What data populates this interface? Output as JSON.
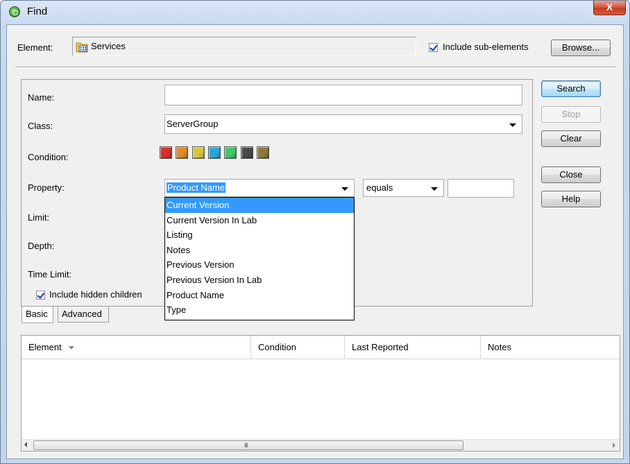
{
  "window": {
    "title": "Find",
    "close_glyph": "X"
  },
  "element": {
    "label": "Element:",
    "value": "Services",
    "icon": "services-folder-icon"
  },
  "include_sub_elements": {
    "label": "Include sub-elements",
    "checked": true
  },
  "buttons": {
    "browse": "Browse...",
    "search": "Search",
    "stop": "Stop",
    "clear": "Clear",
    "close": "Close",
    "help": "Help"
  },
  "form": {
    "name_label": "Name:",
    "name_value": "",
    "class_label": "Class:",
    "class_value": "ServerGroup",
    "condition_label": "Condition:",
    "condition_colors": [
      "#d8302a",
      "#e38a2a",
      "#d8c63a",
      "#2aa8d8",
      "#3ec86a",
      "#4a4a4a",
      "#8c7a3a"
    ],
    "property_label": "Property:",
    "property_value": "Product Name",
    "operator_value": "equals",
    "property_text_value": "",
    "limit_label": "Limit:",
    "depth_label": "Depth:",
    "time_limit_label": "Time Limit:",
    "include_hidden_label": "Include hidden children",
    "include_hidden_checked": true
  },
  "property_options": [
    "Current Version",
    "Current Version In Lab",
    "Listing",
    "Notes",
    "Previous Version",
    "Previous Version In Lab",
    "Product Name",
    "Type"
  ],
  "property_selected_option": "Current Version",
  "tabs": [
    "Basic",
    "Advanced"
  ],
  "active_tab": "Basic",
  "table": {
    "columns": [
      "Element",
      "Condition",
      "Last Reported",
      "Notes"
    ],
    "rows": []
  },
  "scrollbar": {
    "grip": "III"
  }
}
